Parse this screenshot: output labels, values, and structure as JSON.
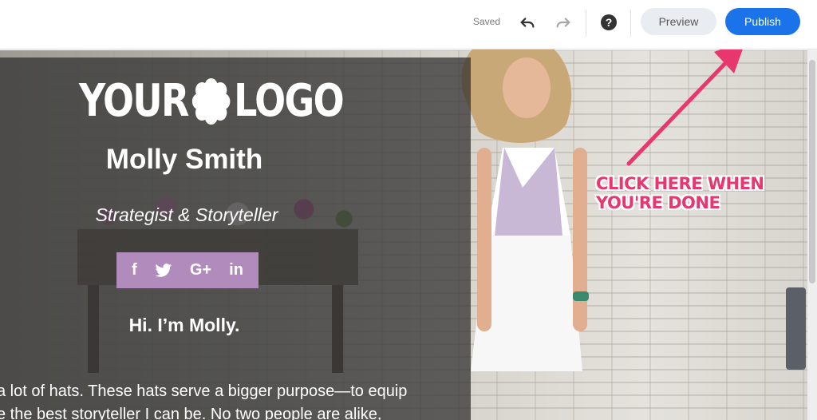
{
  "toolbar": {
    "status": "Saved",
    "help_label": "?",
    "preview_label": "Preview",
    "publish_label": "Publish"
  },
  "site": {
    "logo_left": "YOUR",
    "logo_right": "LOGO",
    "name": "Molly Smith",
    "tagline": "Strategist & Storyteller",
    "social": [
      "f",
      "🐦",
      "G+",
      "in"
    ],
    "greeting": "Hi. I’m Molly.",
    "bio_line1": "a lot of hats. These hats serve a bigger purpose—to equip",
    "bio_line2": "e the best storyteller I can be. No two people are alike,"
  },
  "annotation": {
    "line1": "CLICK HERE WHEN",
    "line2": "YOU'RE DONE"
  },
  "colors": {
    "publish": "#1a73e8",
    "callout": "#e8366f",
    "social_bar": "#b28bbd"
  }
}
